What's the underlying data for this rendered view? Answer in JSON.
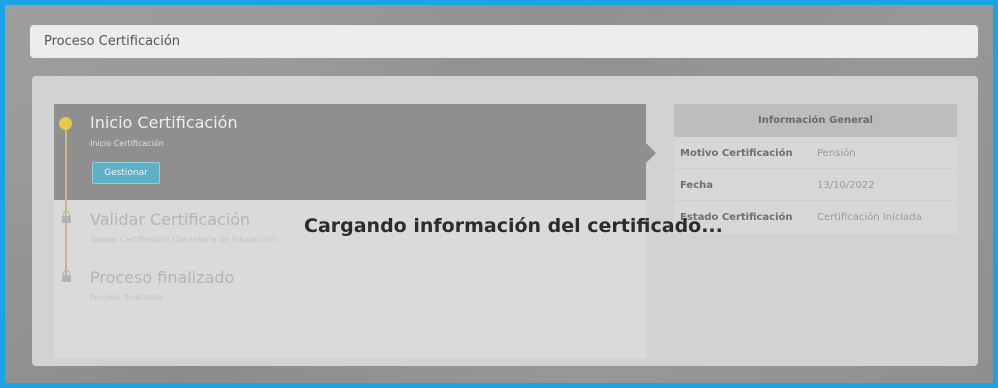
{
  "header": {
    "title": "Proceso Certificación"
  },
  "timeline": {
    "steps": [
      {
        "title": "Inicio Certificación",
        "subtitle": "Inicio Certificación",
        "state": "active",
        "icon": "circle-dot-icon"
      },
      {
        "title": "Validar Certificación",
        "subtitle": "Validar Certificación (Secretaría de Educación)",
        "state": "locked",
        "icon": "lock-icon"
      },
      {
        "title": "Proceso finalizado",
        "subtitle": "Proceso finalizado",
        "state": "locked",
        "icon": "lock-icon"
      }
    ],
    "action_label": "Gestionar"
  },
  "info": {
    "title": "Información General",
    "rows": [
      {
        "label": "Motivo Certificación",
        "value": "Pensión"
      },
      {
        "label": "Fecha",
        "value": "13/10/2022"
      },
      {
        "label": "Estado Certificación",
        "value": "Certificación Iniciada"
      }
    ]
  },
  "overlay": {
    "message": "Cargando información del certificado..."
  },
  "colors": {
    "frame": "#1aa3e6",
    "active_step": "#8f8f8f",
    "dot": "#e8c84a",
    "button": "#5fb0c7"
  }
}
